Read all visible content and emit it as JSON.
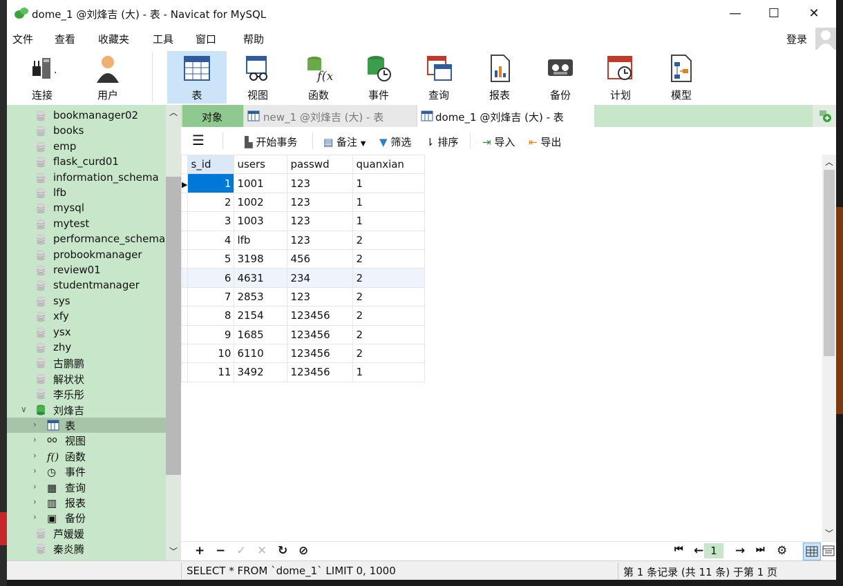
{
  "window": {
    "title": "dome_1 @刘烽吉 (大) - 表 - Navicat for MySQL",
    "min": "—",
    "max": "☐",
    "close": "✕"
  },
  "menu": [
    "文件",
    "查看",
    "收藏夹",
    "工具",
    "窗口",
    "帮助"
  ],
  "login": "登录",
  "toolbar": [
    {
      "label": "连接",
      "icon": "plug-icon"
    },
    {
      "label": "用户",
      "icon": "user-icon"
    },
    {
      "label": "表",
      "icon": "table-icon",
      "selected": true
    },
    {
      "label": "视图",
      "icon": "view-icon"
    },
    {
      "label": "函数",
      "icon": "function-icon"
    },
    {
      "label": "事件",
      "icon": "event-icon"
    },
    {
      "label": "查询",
      "icon": "query-icon"
    },
    {
      "label": "报表",
      "icon": "report-icon"
    },
    {
      "label": "备份",
      "icon": "backup-icon"
    },
    {
      "label": "计划",
      "icon": "schedule-icon"
    },
    {
      "label": "模型",
      "icon": "model-icon"
    }
  ],
  "sidebar": {
    "databases": [
      "bookmanager02",
      "books",
      "emp",
      "flask_curd01",
      "information_schema",
      "lfb",
      "mysql",
      "mytest",
      "performance_schema",
      "probookmanager",
      "review01",
      "studentmanager",
      "sys",
      "xfy",
      "ysx",
      "zhy",
      "古鹏鹏",
      "解状状",
      "李乐彤"
    ],
    "open_db": "刘烽吉",
    "children": [
      "表",
      "视图",
      "函数",
      "事件",
      "查询",
      "报表",
      "备份"
    ],
    "after": [
      "芦媛媛",
      "秦炎腾"
    ]
  },
  "tabs": {
    "objects": "对象",
    "tab1": "new_1 @刘烽吉 (大) - 表",
    "tab2": "dome_1 @刘烽吉 (大) - 表"
  },
  "actions": {
    "begin_tx": "开始事务",
    "memo": "备注",
    "filter": "筛选",
    "sort": "排序",
    "import": "导入",
    "export": "导出"
  },
  "grid": {
    "columns": [
      "s_id",
      "users",
      "passwd",
      "quanxian"
    ],
    "rows": [
      [
        "1",
        "1001",
        "123",
        "1"
      ],
      [
        "2",
        "1002",
        "123",
        "1"
      ],
      [
        "3",
        "1003",
        "123",
        "1"
      ],
      [
        "4",
        "lfb",
        "123",
        "2"
      ],
      [
        "5",
        "3198",
        "456",
        "2"
      ],
      [
        "6",
        "4631",
        "234",
        "2"
      ],
      [
        "7",
        "2853",
        "123",
        "2"
      ],
      [
        "8",
        "2154",
        "123456",
        "2"
      ],
      [
        "9",
        "1685",
        "123456",
        "2"
      ],
      [
        "10",
        "6110",
        "123456",
        "2"
      ],
      [
        "11",
        "3492",
        "123456",
        "1"
      ]
    ],
    "current_row_marker": "▶"
  },
  "pager": {
    "page": "1"
  },
  "status": {
    "sql": "SELECT * FROM `dome_1` LIMIT 0, 1000",
    "records": "第 1 条记录 (共 11 条) 于第 1 页"
  }
}
